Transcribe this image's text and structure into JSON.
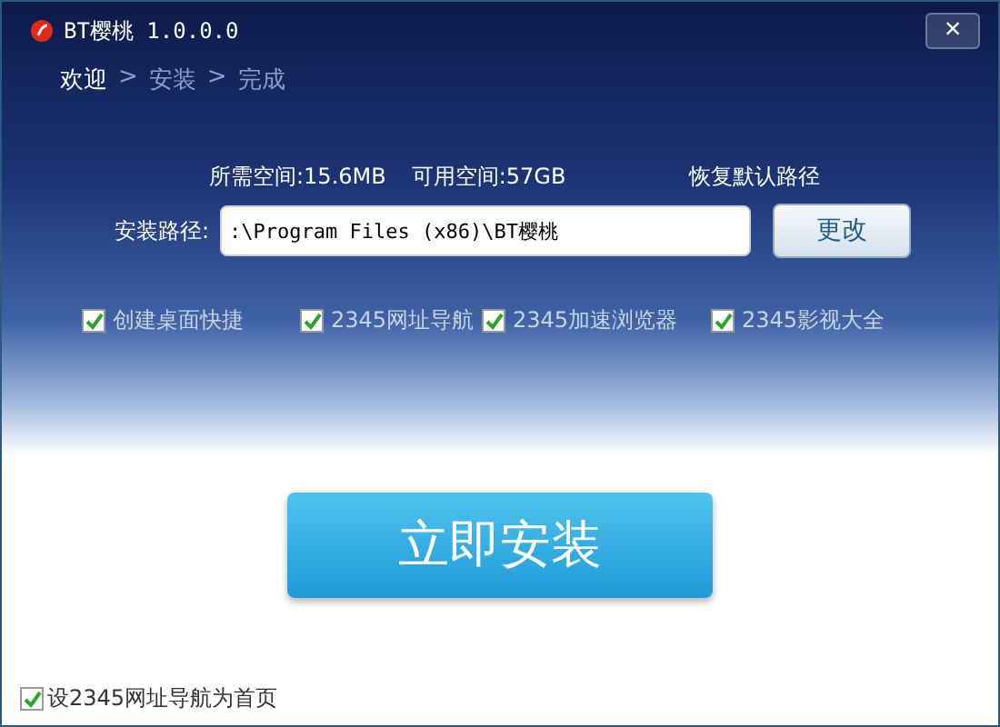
{
  "window": {
    "title": "BT樱桃 1.0.0.0",
    "close": "×"
  },
  "steps": [
    {
      "label": "欢迎",
      "selected": true
    },
    {
      "label": "安装",
      "selected": false
    },
    {
      "label": "完成",
      "selected": false
    }
  ],
  "step_separator": ">",
  "space": {
    "required": "所需空间:15.6MB",
    "available": "可用空间:57GB",
    "restore_default": "恢复默认路径"
  },
  "install_path": {
    "label": "安装路径:",
    "value": ":\\Program Files (x86)\\BT樱桃",
    "change_button": "更改"
  },
  "options": [
    {
      "label": "创建桌面快捷",
      "checked": true
    },
    {
      "label": "2345网址导航",
      "checked": true
    },
    {
      "label": "2345加速浏览器",
      "checked": true
    },
    {
      "label": "2345影视大全",
      "checked": true
    }
  ],
  "install_button": "立即安装",
  "homepage_option": {
    "label": "设2345网址导航为首页",
    "checked": true
  }
}
